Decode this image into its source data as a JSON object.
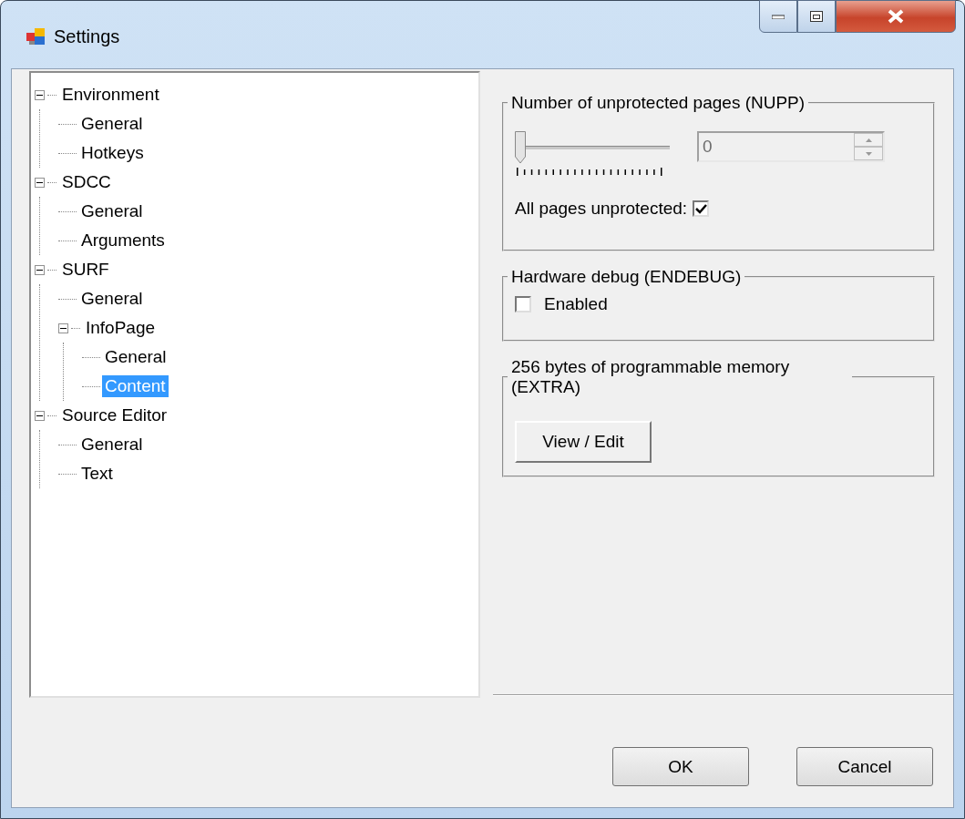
{
  "window": {
    "title": "Settings"
  },
  "tree": [
    {
      "label": "Environment",
      "expanded": true,
      "selected": false,
      "children": [
        {
          "label": "General",
          "selected": false
        },
        {
          "label": "Hotkeys",
          "selected": false
        }
      ]
    },
    {
      "label": "SDCC",
      "expanded": true,
      "selected": false,
      "children": [
        {
          "label": "General",
          "selected": false
        },
        {
          "label": "Arguments",
          "selected": false
        }
      ]
    },
    {
      "label": "SURF",
      "expanded": true,
      "selected": false,
      "children": [
        {
          "label": "General",
          "selected": false
        },
        {
          "label": "InfoPage",
          "expanded": true,
          "selected": false,
          "children": [
            {
              "label": "General",
              "selected": false
            },
            {
              "label": "Content",
              "selected": true
            }
          ]
        }
      ]
    },
    {
      "label": "Source Editor",
      "expanded": true,
      "selected": false,
      "children": [
        {
          "label": "General",
          "selected": false
        },
        {
          "label": "Text",
          "selected": false
        }
      ]
    }
  ],
  "nupp": {
    "title": "Number of unprotected pages (NUPP)",
    "slider": {
      "level": 0
    },
    "spinner": {
      "value": "0",
      "disabled": true
    },
    "all_pages": {
      "label": "All pages unprotected:",
      "checked": true
    }
  },
  "endebug": {
    "title": "Hardware debug (ENDEBUG)",
    "enabled": {
      "label": "Enabled",
      "checked": false
    }
  },
  "extra": {
    "title": "256 bytes of programmable memory (EXTRA)",
    "button": "View / Edit"
  },
  "buttons": [
    "OK",
    "Cancel"
  ]
}
